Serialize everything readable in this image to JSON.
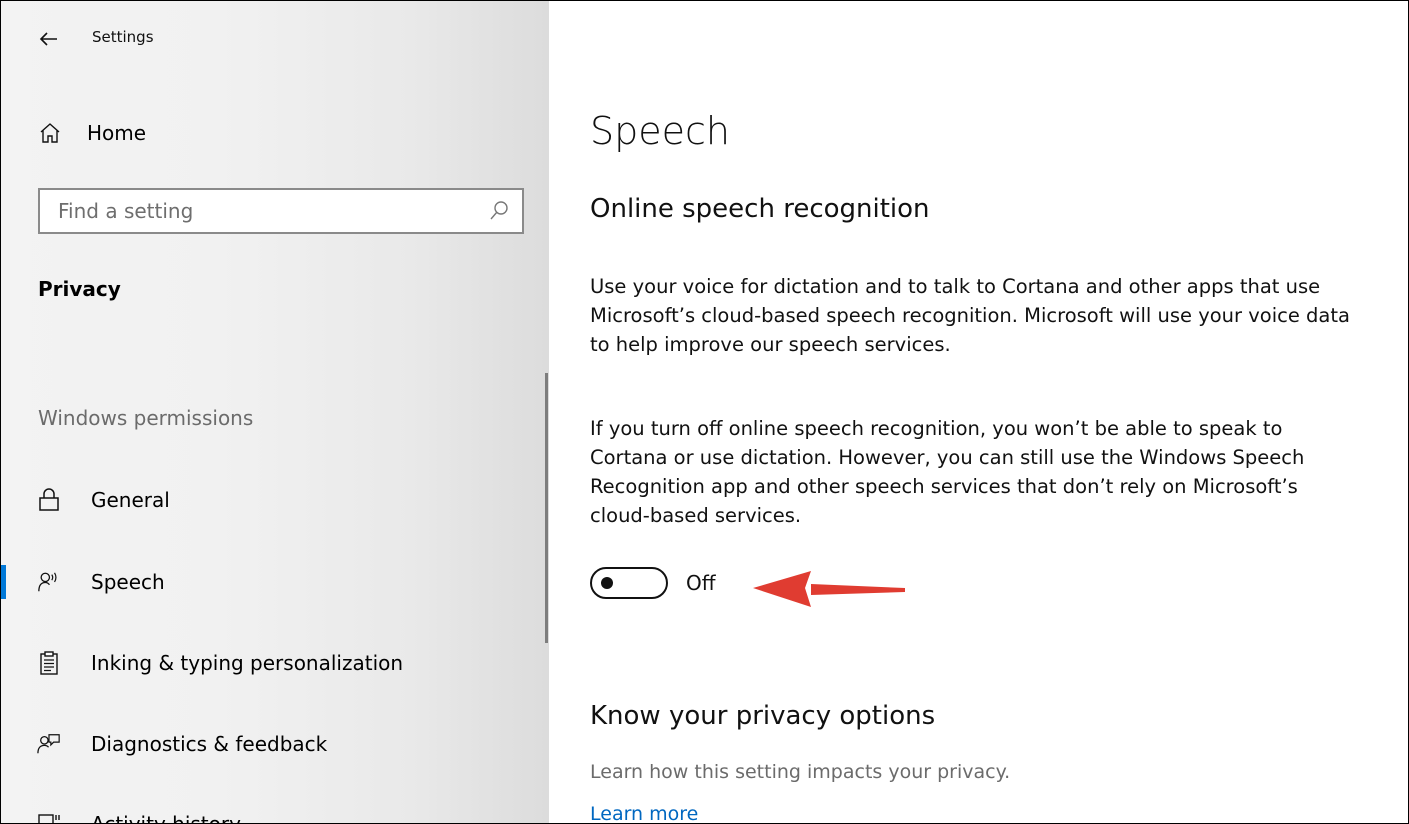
{
  "window": {
    "title": "Settings"
  },
  "sidebar": {
    "home_label": "Home",
    "search": {
      "placeholder": "Find a setting",
      "value": ""
    },
    "section_title": "Privacy",
    "group_label": "Windows permissions",
    "items": [
      {
        "label": "General",
        "icon": "lock-icon"
      },
      {
        "label": "Speech",
        "icon": "speech-icon",
        "selected": true
      },
      {
        "label": "Inking & typing personalization",
        "icon": "clipboard-icon"
      },
      {
        "label": "Diagnostics & feedback",
        "icon": "feedback-icon"
      },
      {
        "label": "Activity history",
        "icon": "activity-icon"
      }
    ]
  },
  "main": {
    "title": "Speech",
    "section": {
      "heading": "Online speech recognition",
      "para1": "Use your voice for dictation and to talk to Cortana and other apps that use Microsoft’s cloud-based speech recognition. Microsoft will use your voice data to help improve our speech services.",
      "para2": "If you turn off online speech recognition, you won’t be able to speak to Cortana or use dictation. However, you can still use the Windows Speech Recognition app and other speech services that don’t rely on Microsoft’s cloud-based services.",
      "toggle_state": "Off"
    },
    "privacy": {
      "heading": "Know your privacy options",
      "description": "Learn how this setting impacts your privacy.",
      "link": "Learn more"
    }
  },
  "colors": {
    "accent": "#0078d7",
    "link": "#0067c0",
    "annotation_arrow": "#e03c31"
  }
}
